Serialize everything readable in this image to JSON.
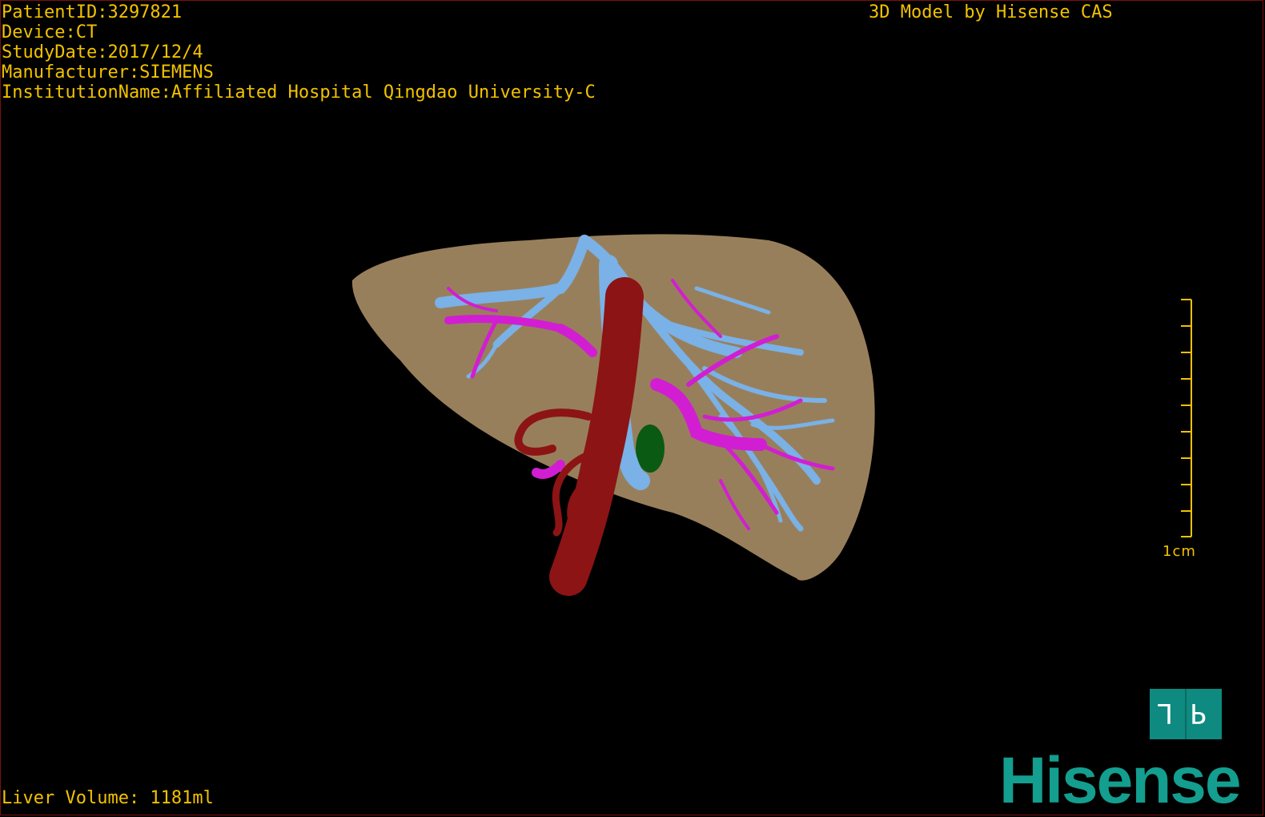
{
  "overlay": {
    "patient_id": "PatientID:3297821",
    "device": "Device:CT",
    "study_date": "StudyDate:2017/12/4",
    "manufacturer": "Manufacturer:SIEMENS",
    "institution": "InstitutionName:Affiliated Hospital Qingdao University-C",
    "model_credit": "3D Model by Hisense CAS",
    "liver_volume": "Liver Volume: 1181ml"
  },
  "scale_bar": {
    "label": "1cm"
  },
  "orientation_cube": {
    "left_glyph": "L",
    "right_glyph": "P"
  },
  "brand": {
    "logo_text": "Hisense"
  },
  "colors": {
    "text": "#f2c200",
    "liver": "#a58a63",
    "portal_vein": "#d21ed2",
    "hepatic_vein": "#7ab1e6",
    "ivc_artery": "#8c1414",
    "gallbladder": "#0b5a13",
    "brand": "#139e8f"
  }
}
